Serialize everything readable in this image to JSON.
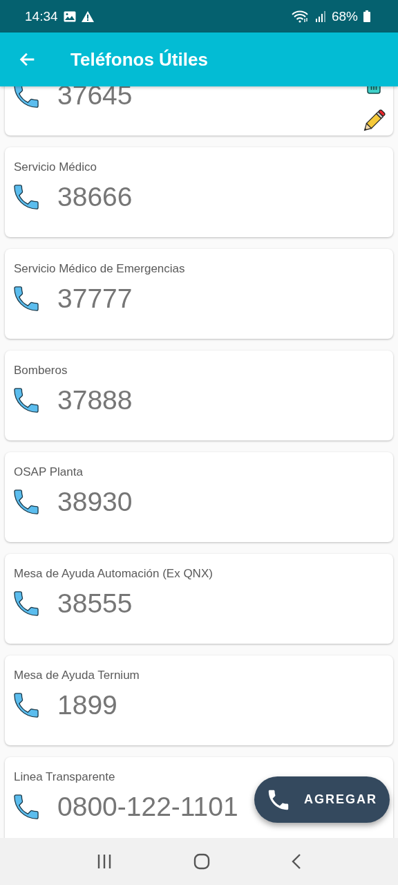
{
  "status_bar": {
    "time": "14:34",
    "battery": "68%"
  },
  "app_bar": {
    "title": "Teléfonos Útiles"
  },
  "contacts": [
    {
      "kind": "partial",
      "number": "37645",
      "editable": true
    },
    {
      "kind": "full",
      "title": "Servicio Médico",
      "number": "38666",
      "editable": false
    },
    {
      "kind": "full",
      "title": "Servicio Médico de Emergencias",
      "number": "37777",
      "editable": false
    },
    {
      "kind": "full",
      "title": "Bomberos",
      "number": "37888",
      "editable": false
    },
    {
      "kind": "full",
      "title": "OSAP Planta",
      "number": "38930",
      "editable": false
    },
    {
      "kind": "full",
      "title": "Mesa de Ayuda Automación (Ex QNX)",
      "number": "38555",
      "editable": false
    },
    {
      "kind": "full",
      "title": "Mesa de Ayuda Ternium",
      "number": "1899",
      "editable": false
    },
    {
      "kind": "full",
      "title": "Linea Transparente",
      "number": "0800-122-1101",
      "editable": false
    }
  ],
  "fab": {
    "label": "AGREGAR"
  }
}
